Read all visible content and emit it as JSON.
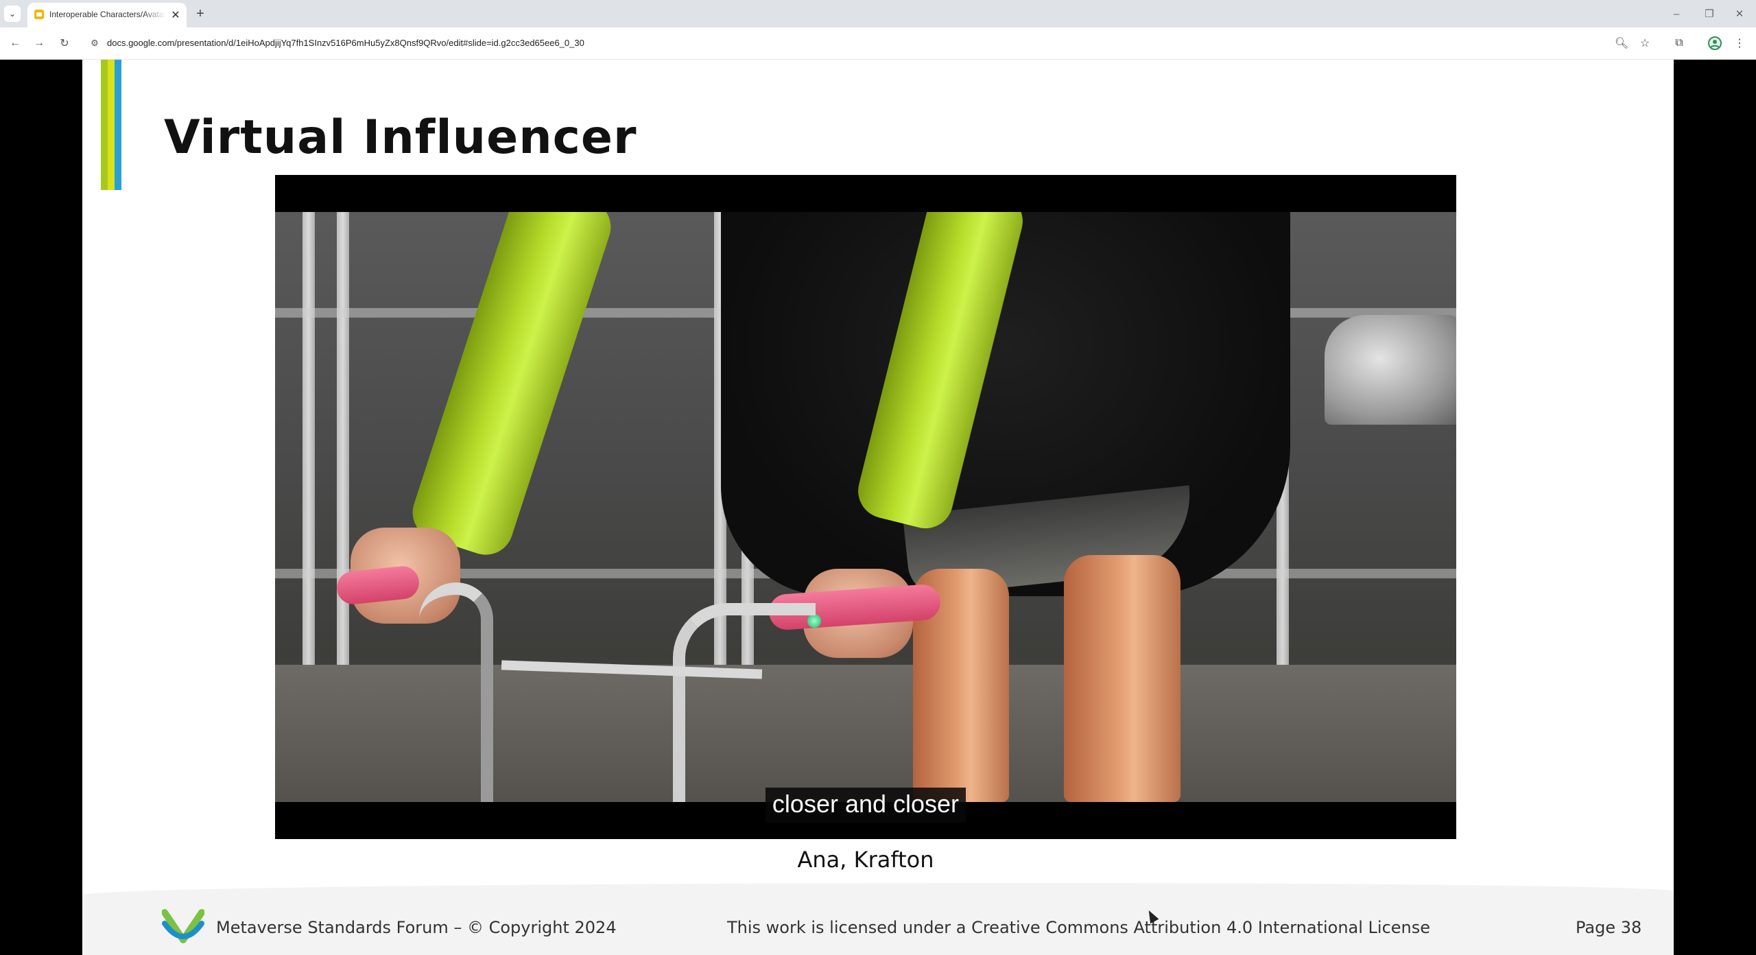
{
  "browser": {
    "tab": {
      "title": "Interoperable Characters/Avatars",
      "close_glyph": "✕"
    },
    "new_tab_glyph": "+",
    "address": {
      "url": "docs.google.com/presentation/d/1eiHoApdjijYq7fh1SInzv516P6mHu5yZx8Qnsf9QRvo/edit#slide=id.g2cc3ed65ee6_0_30"
    },
    "icons": {
      "tab_search": "chevron-down-icon",
      "back": "arrow-left-icon",
      "forward": "arrow-right-icon",
      "reload": "reload-icon",
      "site_info": "tune-icon",
      "zoom": "zoom-icon",
      "bookmark": "star-icon",
      "extensions": "puzzle-icon",
      "profile": "profile-icon",
      "menu": "kebab-menu-icon"
    }
  },
  "slide": {
    "title": "Virtual Influencer",
    "accent_colors": [
      "#a8c81e",
      "#d8e21c",
      "#2a9fd6"
    ],
    "video": {
      "caption": "closer and closer"
    },
    "video_credit": "Ana, Krafton",
    "footer": {
      "org": "Metaverse Standards Forum – © Copyright 2024",
      "license": "This work is licensed under a Creative Commons Attribution 4.0 International License",
      "page": "Page 38"
    }
  }
}
